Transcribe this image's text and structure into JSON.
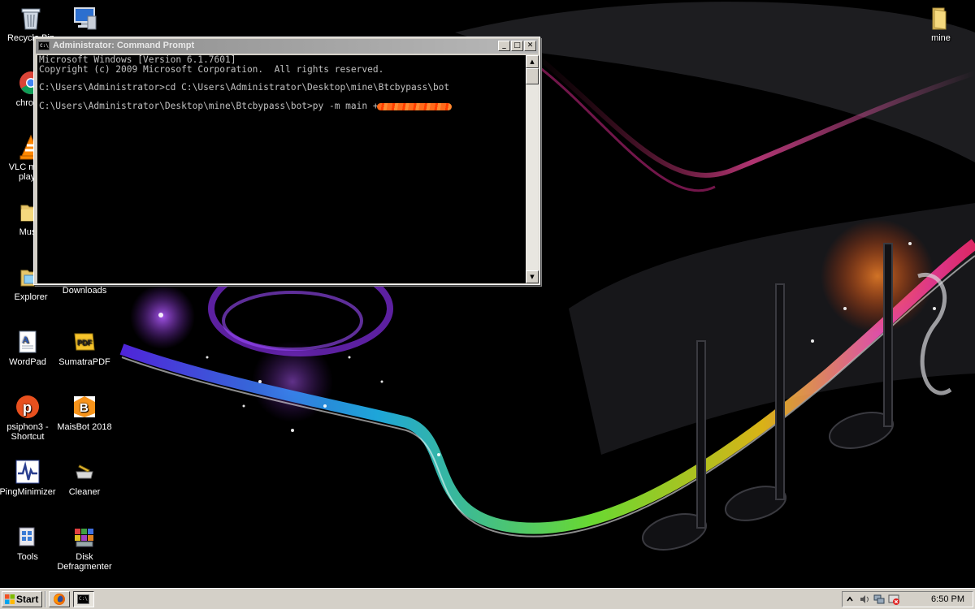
{
  "desktop": {
    "icons": [
      {
        "label": "Recycle Bin",
        "icon": "recycle-bin-icon"
      },
      {
        "label": "",
        "icon": "computer-icon"
      },
      {
        "label": "chrome",
        "icon": "chrome-icon"
      },
      {
        "label": "VLC media player",
        "icon": "vlc-icon"
      },
      {
        "label": "Music",
        "icon": "folder-icon"
      },
      {
        "label": "Explorer",
        "icon": "explorer-icon"
      },
      {
        "label": "Downloads",
        "icon": "downloads-icon"
      },
      {
        "label": "WordPad",
        "icon": "wordpad-icon"
      },
      {
        "label": "SumatraPDF",
        "icon": "sumatrapdf-icon"
      },
      {
        "label": "psiphon3 - Shortcut",
        "icon": "psiphon-icon"
      },
      {
        "label": "MaisBot 2018",
        "icon": "maisbot-icon"
      },
      {
        "label": "PingMinimizer",
        "icon": "pingminimizer-icon"
      },
      {
        "label": "Cleaner",
        "icon": "cleaner-icon"
      },
      {
        "label": "Tools",
        "icon": "tools-icon"
      },
      {
        "label": "Disk Defragmenter",
        "icon": "disk-defragmenter-icon"
      },
      {
        "label": "mine",
        "icon": "folder-icon"
      }
    ]
  },
  "cmd": {
    "title": "Administrator: Command Prompt",
    "title_icon_text": "C:\\",
    "lines": [
      "Microsoft Windows [Version 6.1.7601]",
      "Copyright (c) 2009 Microsoft Corporation.  All rights reserved.",
      "C:\\Users\\Administrator>cd C:\\Users\\Administrator\\Desktop\\mine\\Btcbypass\\bot",
      "C:\\Users\\Administrator\\Desktop\\mine\\Btcbypass\\bot>py -m main +"
    ],
    "buttons": {
      "minimize": "_",
      "maximize": "□",
      "close": "✕"
    },
    "scroll_up": "▲",
    "scroll_down": "▼"
  },
  "taskbar": {
    "start_label": "Start",
    "quick_launch": [
      "firefox-icon",
      "command-prompt-icon"
    ],
    "tray_icons": [
      "chevron-icon",
      "volume-icon",
      "network-icon",
      "alert-icon"
    ],
    "clock": "6:50 PM"
  },
  "colors": {
    "console_bg": "#000000",
    "console_text": "#c0c0c0",
    "taskbar": "#d4d0c8",
    "redaction": "#ff5a10"
  }
}
